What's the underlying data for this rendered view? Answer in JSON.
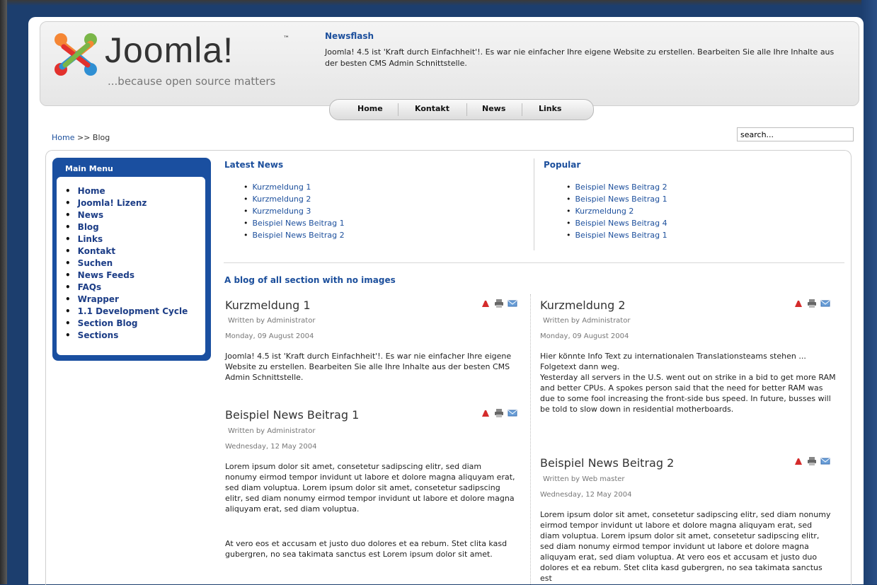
{
  "header": {
    "logo_text": "Joomla!",
    "logo_tm": "™",
    "tagline": "...because open source matters",
    "newsflash_title": "Newsflash",
    "newsflash_text": "Joomla! 4.5 ist 'Kraft durch Einfachheit'!. Es war nie einfacher Ihre eigene Website zu erstellen. Bearbeiten Sie alle Ihre Inhalte aus der besten CMS Admin Schnittstelle."
  },
  "nav": [
    "Home",
    "Kontakt",
    "News",
    "Links"
  ],
  "breadcrumb": {
    "home": "Home",
    "sep": ">>",
    "current": "Blog"
  },
  "search": {
    "value": "search..."
  },
  "main_menu": {
    "title": "Main Menu",
    "items": [
      "Home",
      "Joomla! Lizenz",
      "News",
      "Blog",
      "Links",
      "Kontakt",
      "Suchen",
      "News Feeds",
      "FAQs",
      "Wrapper",
      "1.1 Development Cycle",
      "Section Blog",
      "Sections"
    ]
  },
  "latest_news": {
    "title": "Latest News",
    "items": [
      "Kurzmeldung 1",
      "Kurzmeldung 2",
      "Kurzmeldung 3",
      "Beispiel News Beitrag 1",
      "Beispiel News Beitrag 2"
    ]
  },
  "popular": {
    "title": "Popular",
    "items": [
      "Beispiel News Beitrag 2",
      "Beispiel News Beitrag 1",
      "Kurzmeldung 2",
      "Beispiel News Beitrag 4",
      "Beispiel News Beitrag 1"
    ]
  },
  "blog": {
    "title": "A blog of all section with no images",
    "articles": [
      {
        "title": "Kurzmeldung 1",
        "author": "Written by Administrator",
        "date": "Monday, 09 August 2004",
        "text": "Joomla! 4.5 ist 'Kraft durch Einfachheit'!. Es war nie einfacher Ihre eigene Website zu erstellen. Bearbeiten Sie alle Ihre Inhalte aus der besten CMS Admin Schnittstelle."
      },
      {
        "title": "Kurzmeldung 2",
        "author": "Written by Administrator",
        "date": "Monday, 09 August 2004",
        "text": "Hier könnte Info Text zu internationalen Translationsteams stehen ... Folgetext dann weg.\nYesterday all servers in the U.S. went out on strike in a bid to get more RAM and better CPUs. A spokes person said that the need for better RAM was due to some fool increasing the front-side bus speed. In future, busses will be told to slow down in residential motherboards."
      },
      {
        "title": "Beispiel News Beitrag 1",
        "author": "Written by Administrator",
        "date": "Wednesday, 12 May 2004",
        "text": "Lorem ipsum dolor sit amet, consetetur sadipscing elitr, sed diam nonumy eirmod tempor invidunt ut labore et dolore magna aliquyam erat, sed diam voluptua. Lorem ipsum dolor sit amet, consetetur sadipscing elitr, sed diam nonumy eirmod tempor invidunt ut labore et dolore magna aliquyam erat, sed diam voluptua.",
        "text2": "At vero eos et accusam et justo duo dolores et ea rebum. Stet clita kasd gubergren, no sea takimata sanctus est Lorem ipsum dolor sit amet."
      },
      {
        "title": "Beispiel News Beitrag 2",
        "author": "Written by Web master",
        "date": "Wednesday, 12 May 2004",
        "text": "Lorem ipsum dolor sit amet, consetetur sadipscing elitr, sed diam nonumy eirmod tempor invidunt ut labore et dolore magna aliquyam erat, sed diam voluptua. Lorem ipsum dolor sit amet, consetetur sadipscing elitr, sed diam nonumy eirmod tempor invidunt ut labore et dolore magna aliquyam erat, sed diam voluptua. At vero eos et accusam et justo duo dolores et ea rebum. Stet clita kasd gubergren, no sea takimata sanctus est"
      }
    ]
  },
  "icons": {
    "pdf": "pdf-icon",
    "print": "print-icon",
    "email": "email-icon"
  },
  "colors": {
    "background": "#1c3e6e",
    "link": "#1c4f9c",
    "menu": "#1a4fa0"
  }
}
